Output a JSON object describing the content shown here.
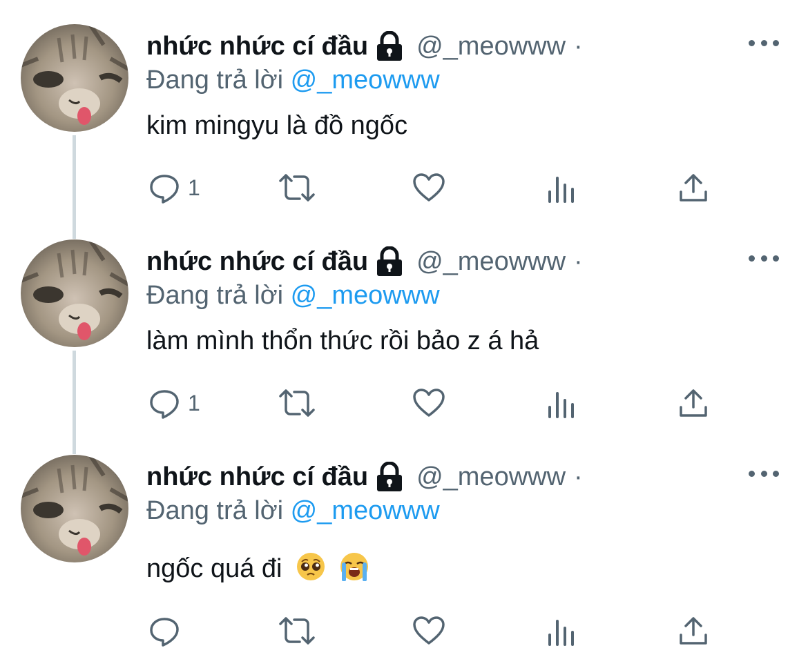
{
  "colors": {
    "text": "#0f1419",
    "secondary": "#536471",
    "link": "#1d9bf0",
    "thread_line": "#cfd9de"
  },
  "tweets": [
    {
      "display_name": "nhức nhức cí đầu",
      "handle": "@_meowww",
      "dot": "·",
      "reply_prefix": "Đang trả lời",
      "reply_to": "@_meowww",
      "text": "kim mingyu là đồ ngốc",
      "reply_count": "1",
      "emojis": []
    },
    {
      "display_name": "nhức nhức cí đầu",
      "handle": "@_meowww",
      "dot": "·",
      "reply_prefix": "Đang trả lời",
      "reply_to": "@_meowww",
      "text": "làm mình thổn thức rồi bảo z á hả",
      "reply_count": "1",
      "emojis": []
    },
    {
      "display_name": "nhức nhức cí đầu",
      "handle": "@_meowww",
      "dot": "·",
      "reply_prefix": "Đang trả lời",
      "reply_to": "@_meowww",
      "text": "ngốc quá đi",
      "reply_count": "",
      "emojis": [
        "pleading-face",
        "loudly-crying-face"
      ]
    }
  ],
  "icons": {
    "reply": "reply-icon",
    "retweet": "retweet-icon",
    "like": "like-icon",
    "views": "views-icon",
    "share": "share-icon",
    "lock": "lock-icon",
    "more": "more-icon"
  }
}
